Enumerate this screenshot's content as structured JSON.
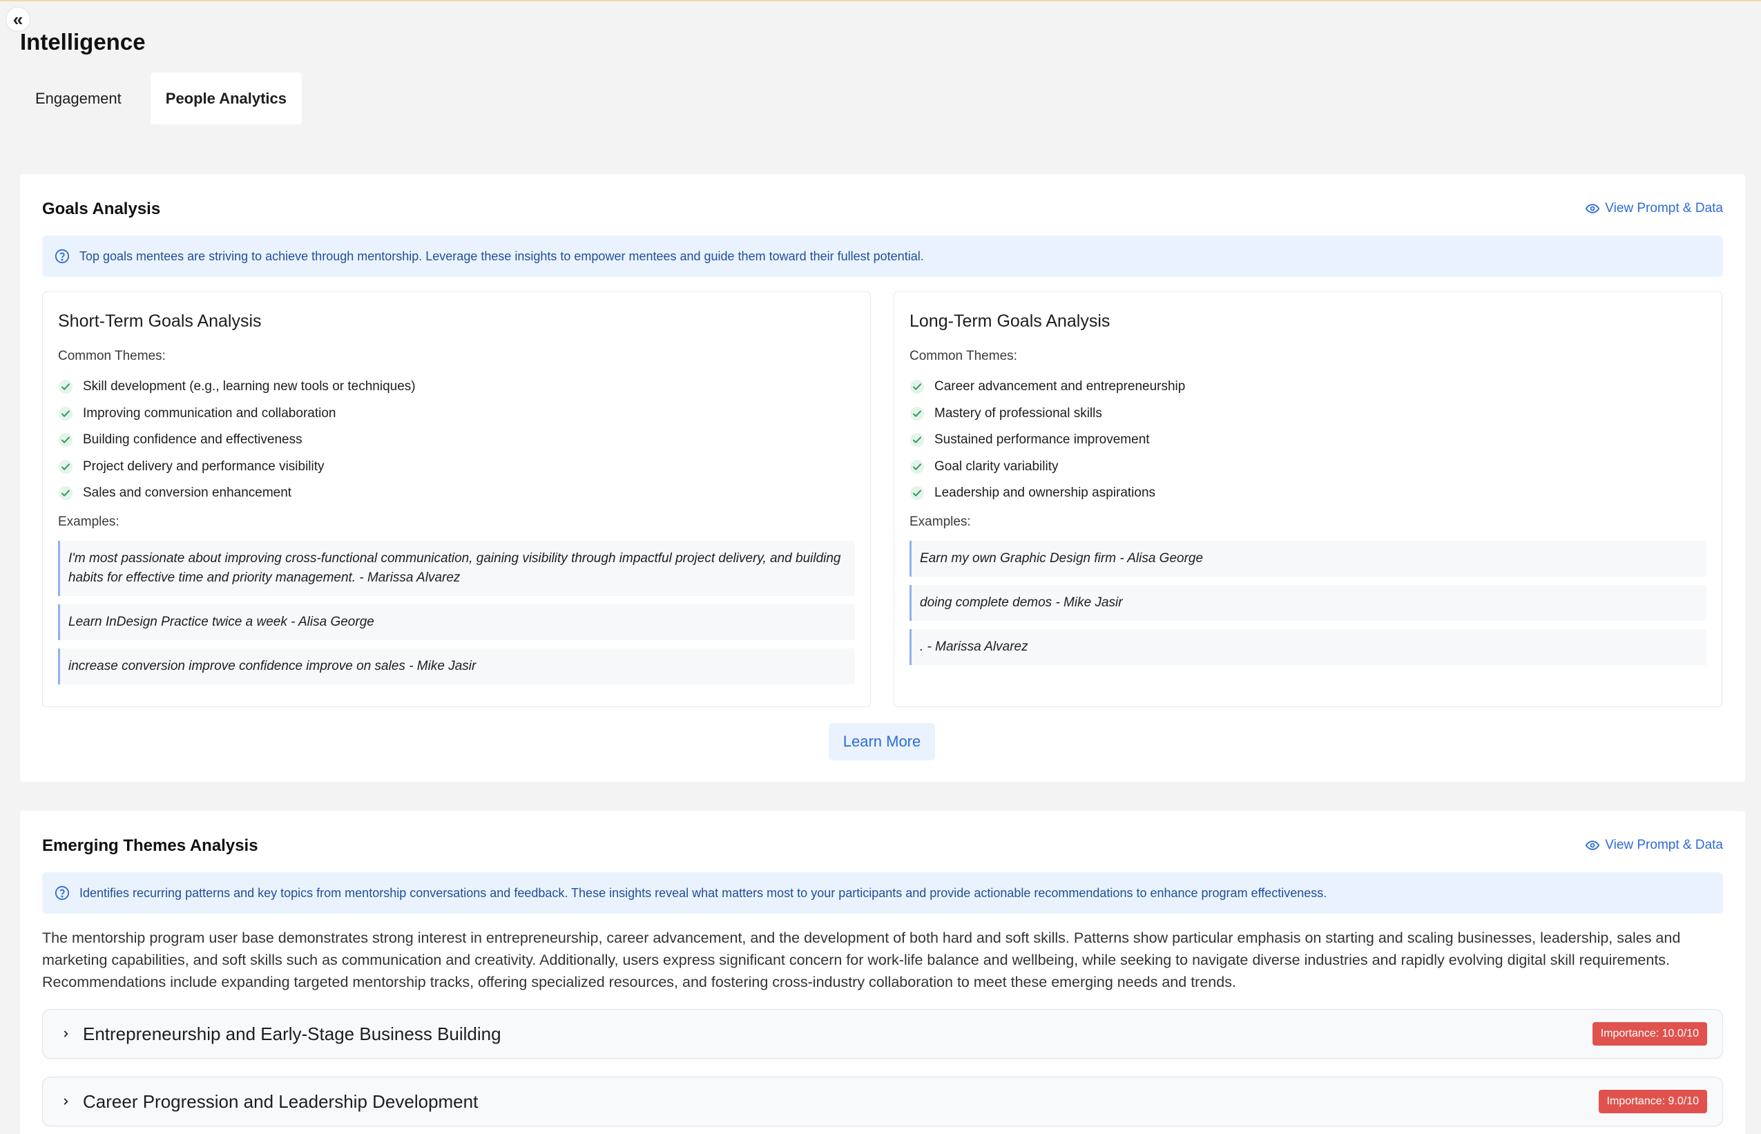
{
  "header": {
    "collapse_glyph": "«",
    "title": "Intelligence"
  },
  "tabs": [
    {
      "label": "Engagement",
      "active": false
    },
    {
      "label": "People Analytics",
      "active": true
    }
  ],
  "goals": {
    "title": "Goals Analysis",
    "view_link": "View Prompt & Data",
    "info": "Top goals mentees are striving to achieve through mentorship. Leverage these insights to empower mentees and guide them toward their fullest potential.",
    "short_term": {
      "title": "Short-Term Goals Analysis",
      "themes_label": "Common Themes:",
      "themes": [
        "Skill development (e.g., learning new tools or techniques)",
        "Improving communication and collaboration",
        "Building confidence and effectiveness",
        "Project delivery and performance visibility",
        "Sales and conversion enhancement"
      ],
      "examples_label": "Examples:",
      "examples": [
        "I'm most passionate about improving cross-functional communication, gaining visibility through impactful project delivery, and building habits for effective time and priority management. - Marissa Alvarez",
        "Learn InDesign Practice twice a week - Alisa George",
        "increase conversion improve confidence improve on sales - Mike Jasir"
      ]
    },
    "long_term": {
      "title": "Long-Term Goals Analysis",
      "themes_label": "Common Themes:",
      "themes": [
        "Career advancement and entrepreneurship",
        "Mastery of professional skills",
        "Sustained performance improvement",
        "Goal clarity variability",
        "Leadership and ownership aspirations"
      ],
      "examples_label": "Examples:",
      "examples": [
        "Earn my own Graphic Design firm - Alisa George",
        "doing complete demos - Mike Jasir",
        ". - Marissa Alvarez"
      ]
    },
    "learn_more": "Learn More"
  },
  "themes_panel": {
    "title": "Emerging Themes Analysis",
    "view_link": "View Prompt & Data",
    "info": "Identifies recurring patterns and key topics from mentorship conversations and feedback. These insights reveal what matters most to your participants and provide actionable recommendations to enhance program effectiveness.",
    "summary": "The mentorship program user base demonstrates strong interest in entrepreneurship, career advancement, and the development of both hard and soft skills. Patterns show particular emphasis on starting and scaling businesses, leadership, sales and marketing capabilities, and soft skills such as communication and creativity. Additionally, users express significant concern for work-life balance and wellbeing, while seeking to navigate diverse industries and rapidly evolving digital skill requirements. Recommendations include expanding targeted mentorship tracks, offering specialized resources, and fostering cross-industry collaboration to meet these emerging needs and trends.",
    "items": [
      {
        "title": "Entrepreneurship and Early-Stage Business Building",
        "badge": "Importance: 10.0/10"
      },
      {
        "title": "Career Progression and Leadership Development",
        "badge": "Importance: 9.0/10"
      }
    ]
  },
  "colors": {
    "accent": "#2d6bd6",
    "info_bg": "#eaf3fd",
    "check": "#2e9e5b",
    "badge": "#e0524d"
  }
}
